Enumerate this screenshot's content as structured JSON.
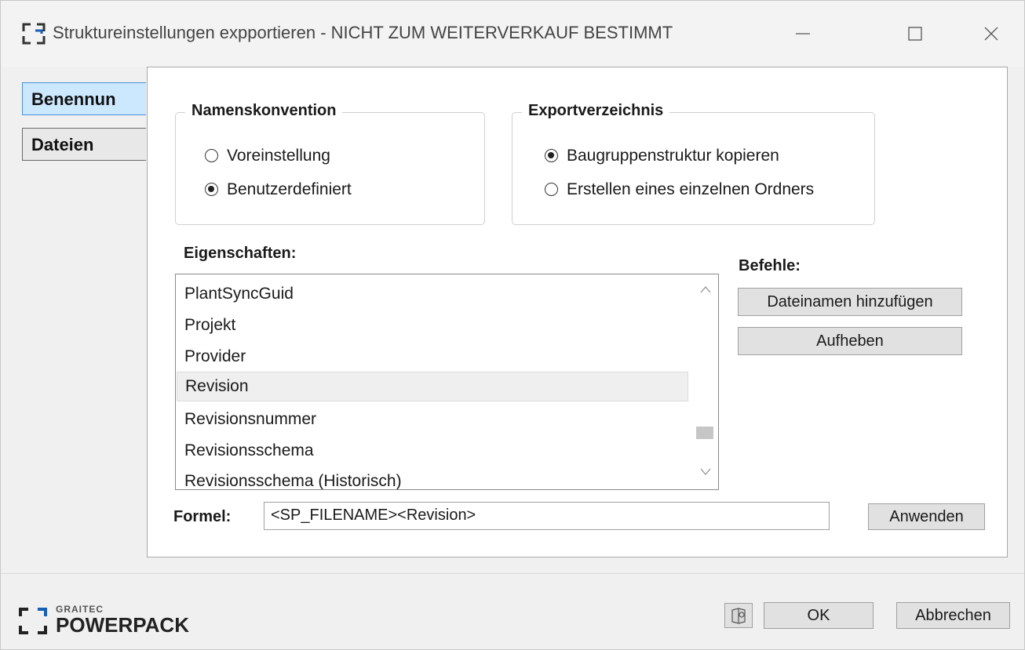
{
  "window": {
    "title": "Struktureinstellungen expportieren - NICHT ZUM WEITERVERKAUF BESTIMMT",
    "controls": {
      "minimize": "minimize-icon",
      "maximize": "maximize-icon",
      "close": "close-icon"
    }
  },
  "tabs": [
    {
      "label": "Benennun",
      "active": true
    },
    {
      "label": "Dateien",
      "active": false
    }
  ],
  "naming": {
    "title": "Namenskonvention",
    "options": [
      {
        "label": "Voreinstellung",
        "checked": false
      },
      {
        "label": "Benutzerdefiniert",
        "checked": true
      }
    ]
  },
  "export_dir": {
    "title": "Exportverzeichnis",
    "options": [
      {
        "label": "Baugruppenstruktur kopieren",
        "checked": true
      },
      {
        "label": "Erstellen eines einzelnen Ordners",
        "checked": false
      }
    ]
  },
  "properties": {
    "label": "Eigenschaften:",
    "items": [
      "PlantSyncGuid",
      "Projekt",
      "Provider",
      "Revision",
      "Revisionsnummer",
      "Revisionsschema",
      "Revisionsschema (Historisch)"
    ],
    "selected_index": 3
  },
  "commands": {
    "label": "Befehle:",
    "add_filename": "Dateinamen hinzufügen",
    "undo": "Aufheben"
  },
  "formula": {
    "label": "Formel:",
    "value": "<SP_FILENAME><Revision>",
    "apply": "Anwenden"
  },
  "footer": {
    "logo_small": "GRAITEC",
    "logo_big": "POWERPACK",
    "help_icon": "help-book-icon",
    "ok": "OK",
    "cancel": "Abbrechen"
  },
  "colors": {
    "active_tab": "#cce8ff",
    "button": "#e1e1e1",
    "selected_row": "#efefef"
  }
}
